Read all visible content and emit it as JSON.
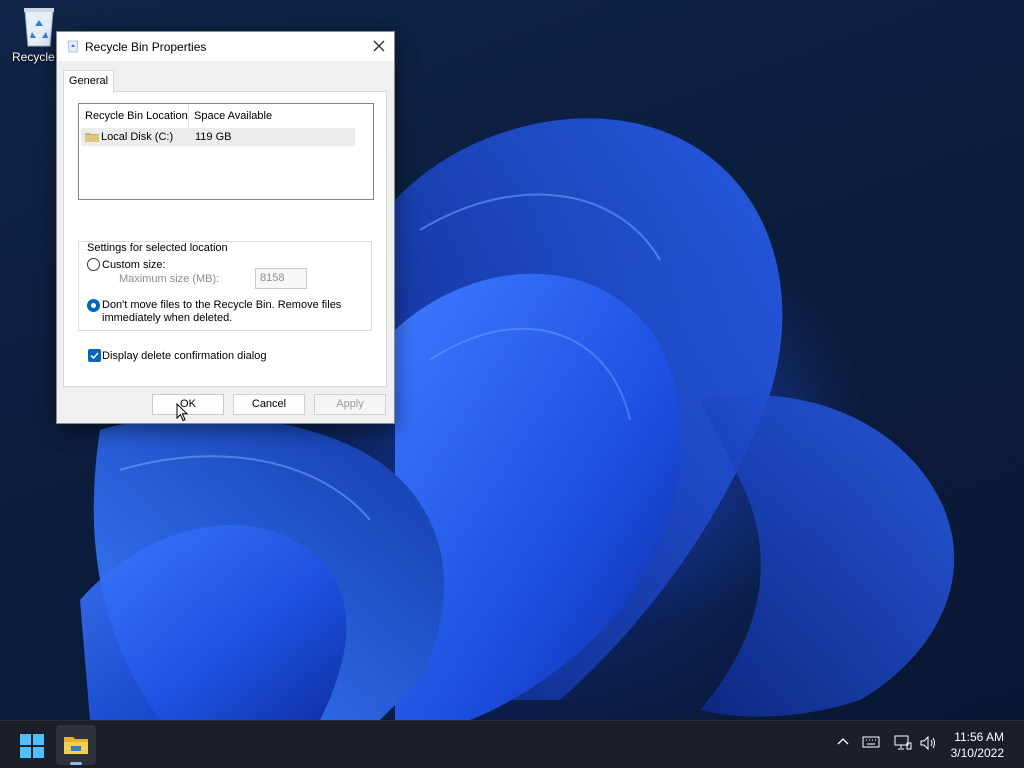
{
  "desktop": {
    "icons": [
      {
        "label": "Recycle B",
        "icon": "recycle-bin-icon"
      }
    ]
  },
  "dialog": {
    "title": "Recycle Bin Properties",
    "tabs": [
      {
        "label": "General"
      }
    ],
    "list": {
      "columns": [
        "Recycle Bin Location",
        "Space Available"
      ],
      "rows": [
        {
          "location": "Local Disk (C:)",
          "space": "119 GB"
        }
      ]
    },
    "settings": {
      "group_label": "Settings for selected location",
      "custom_size_label": "Custom size:",
      "max_size_label": "Maximum size (MB):",
      "max_size_value": "8158",
      "dont_move_label_line1": "Don't move files to the Recycle Bin. Remove files",
      "dont_move_label_line2": "immediately when deleted.",
      "selected_option": "dont_move",
      "confirm_label": "Display delete confirmation dialog",
      "confirm_checked": true
    },
    "buttons": {
      "ok": "OK",
      "cancel": "Cancel",
      "apply": "Apply"
    }
  },
  "taskbar": {
    "time": "11:56 AM",
    "date": "3/10/2022",
    "accent": "#0067c0"
  }
}
